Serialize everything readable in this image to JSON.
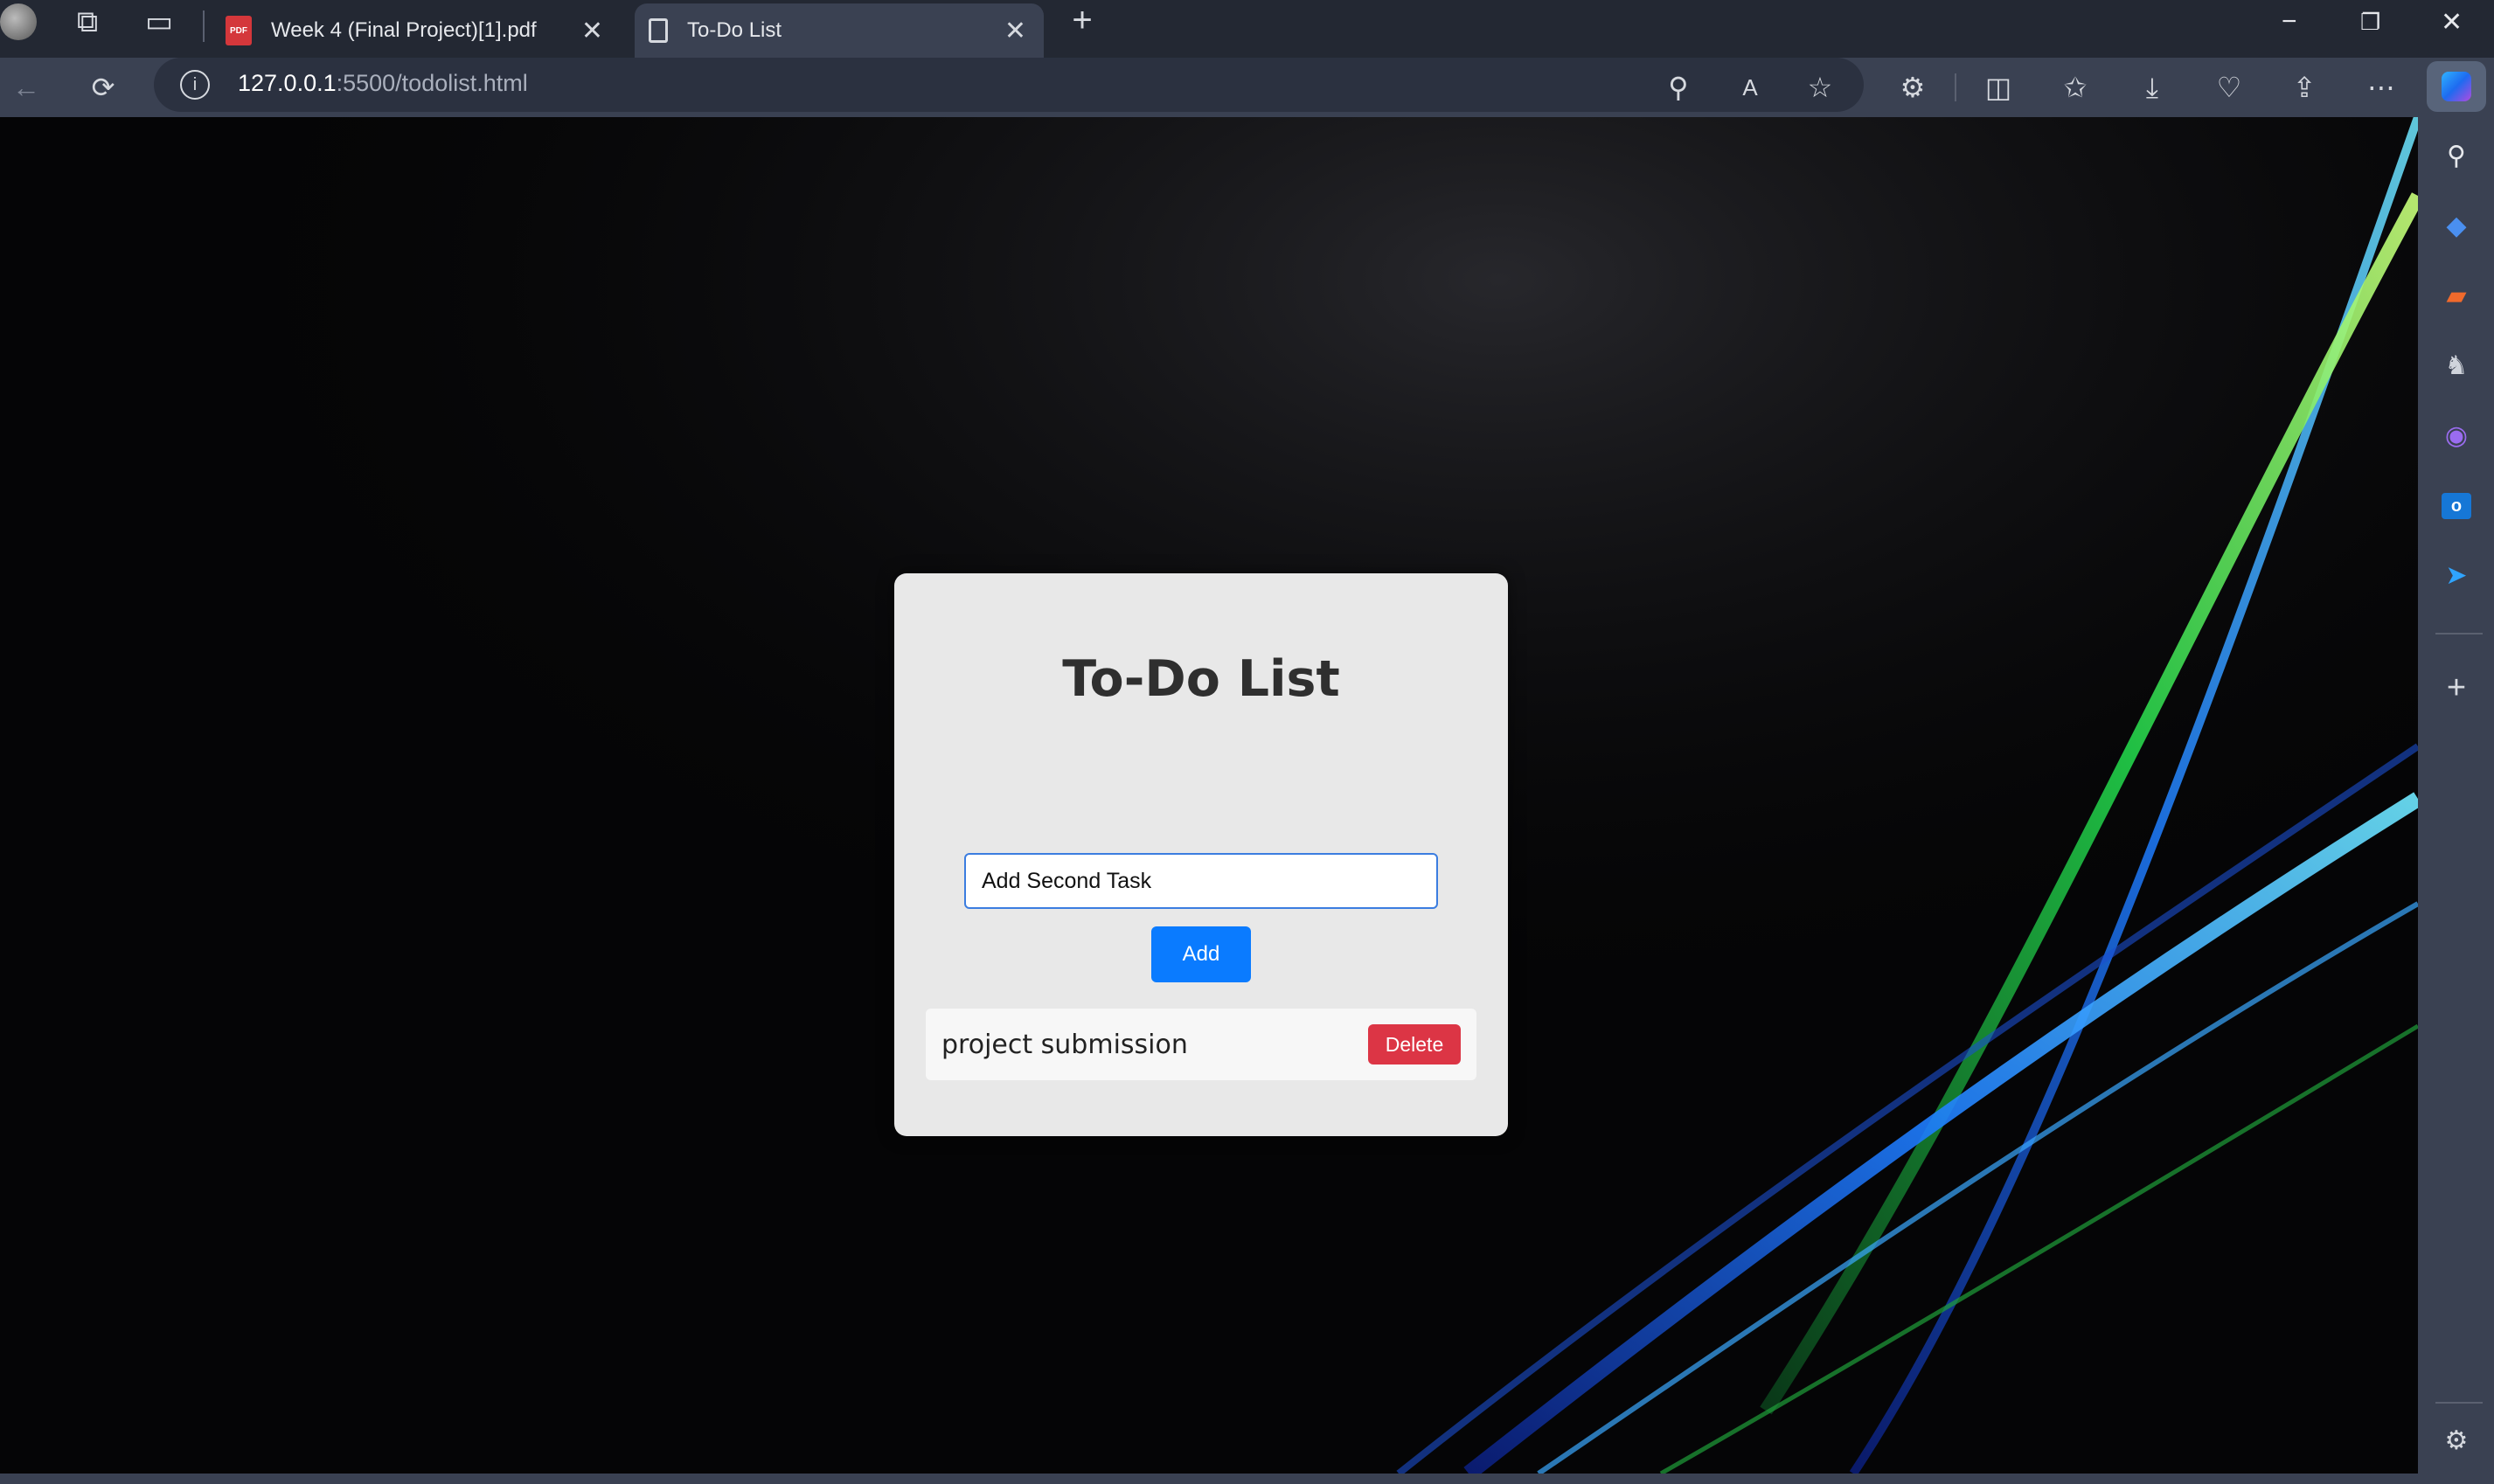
{
  "browser": {
    "tabs": [
      {
        "label": "Week 4 (Final Project)[1].pdf",
        "icon": "pdf-icon"
      },
      {
        "label": "To-Do List",
        "icon": "page-icon",
        "active": true
      }
    ],
    "address": {
      "host": "127.0.0.1",
      "path": ":5500/todolist.html"
    },
    "pdf_icon_text": "PDF"
  },
  "app": {
    "title": "To-Do List",
    "input": {
      "value": "Add Second Task"
    },
    "add_label": "Add",
    "todos": [
      {
        "text": "project submission",
        "delete_label": "Delete"
      }
    ]
  },
  "colors": {
    "accent": "#0a7bff",
    "danger": "#dc3545",
    "card": "#e8e8e8"
  }
}
